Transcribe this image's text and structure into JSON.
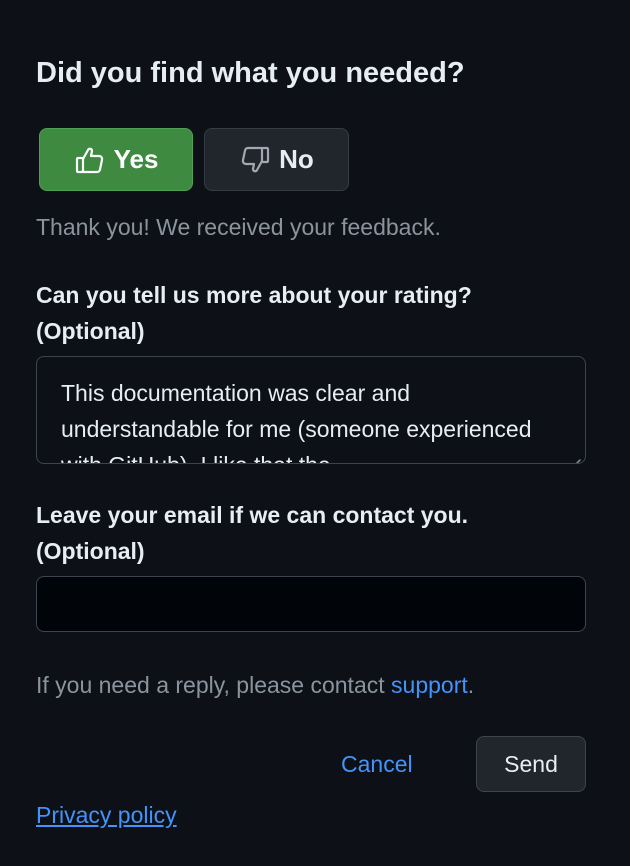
{
  "feedback": {
    "title": "Did you find what you needed?",
    "yes_label": "Yes",
    "no_label": "No",
    "thanks_message": "Thank you! We received your feedback.",
    "rating_label_line1": "Can you tell us more about your rating?",
    "rating_label_line2": "(Optional)",
    "rating_text": "This documentation was clear and understandable for me (someone experienced with GitHub). I like that the",
    "email_label_line1": "Leave your email if we can contact you.",
    "email_label_line2": "(Optional)",
    "email_value": "",
    "reply_prefix": "If you need a reply, please contact ",
    "reply_link": "support",
    "reply_suffix": ".",
    "cancel_label": "Cancel",
    "send_label": "Send",
    "privacy_label": "Privacy policy"
  },
  "icons": {
    "yes": "thumbs-up-icon",
    "no": "thumbs-down-icon",
    "resize": "resize-handle-icon"
  },
  "colors": {
    "background": "#0d1117",
    "yes_button": "#3d8a40",
    "link": "#4493f8",
    "muted_text": "#8b949e"
  }
}
